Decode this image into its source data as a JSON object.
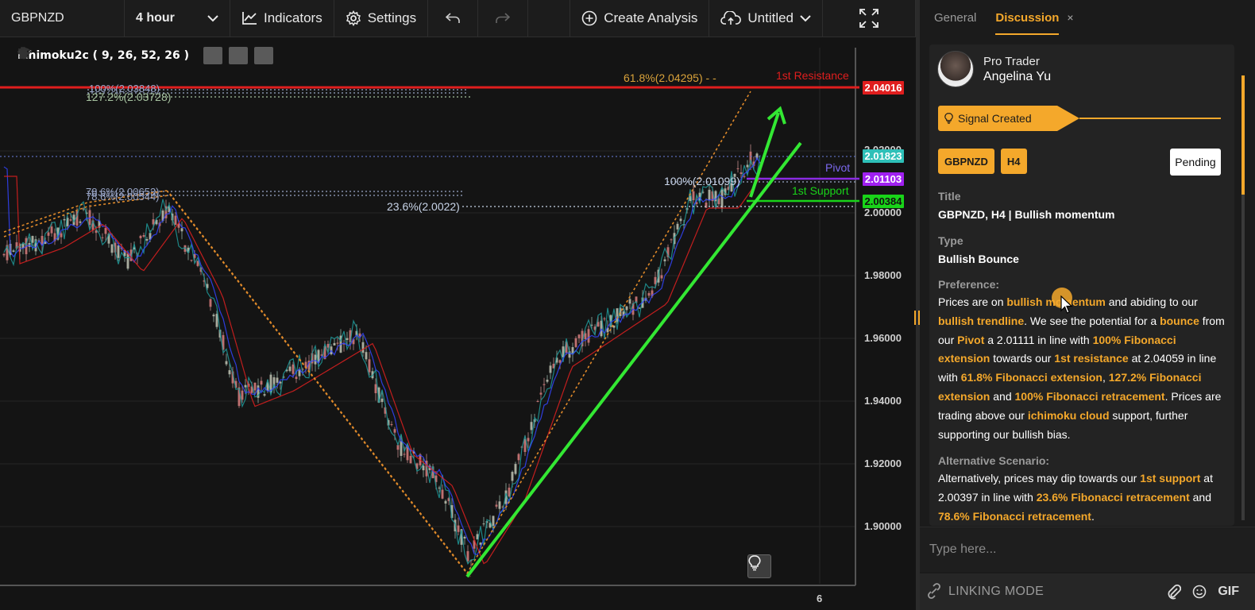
{
  "toolbar": {
    "symbol": "GBPNZD",
    "interval": "4 hour",
    "indicators_label": "Indicators",
    "settings_label": "Settings",
    "create_analysis_label": "Create Analysis",
    "layout_name": "Untitled"
  },
  "chart": {
    "indicator": "Ichimoku2c ( 9, 26, 52, 26 )",
    "price_axis": [
      "2.02000",
      "2.00000",
      "1.98000",
      "1.96000",
      "1.94000",
      "1.92000",
      "1.90000"
    ],
    "price_tags": {
      "resistance": "2.04016",
      "current": "2.01823",
      "pivot": "2.01103",
      "support": "2.00384"
    },
    "line_labels": {
      "resistance": "1st Resistance",
      "pivot": "Pivot",
      "support": "1st Support"
    },
    "fib_labels": {
      "ext_618": "61.8%(2.04295)",
      "retr_100": "100%(2.03848)",
      "ext_1272": "127.2%(2.03728)",
      "retr_786": "78.6%(2.00653)",
      "retr_786b": "78.6%(2.00544)",
      "ext_100": "100%(2.01099)",
      "retr_236": "23.6%(2.0022)"
    },
    "x_tick": "6",
    "colors": {
      "resistance": "#e01e1e",
      "pivot": "#8a2be2",
      "support": "#19d419",
      "trend": "#33e833",
      "current": "#2ec0b8",
      "fib": "#e08a2a"
    }
  },
  "panel": {
    "tabs": [
      "General",
      "Discussion"
    ],
    "active_tab": "Discussion",
    "close_symbol": "×",
    "author_role": "Pro Trader",
    "author_name": "Angelina Yu",
    "signal_status": "Signal Created",
    "tags": [
      "GBPNZD",
      "H4"
    ],
    "state": "Pending",
    "title_label": "Title",
    "title_value": "GBPNZD, H4 | Bullish momentum",
    "type_label": "Type",
    "type_value": "Bullish Bounce",
    "preference_label": "Preference:",
    "alternative_label": "Alternative Scenario:",
    "preference_segments": [
      {
        "t": "Prices are on ",
        "h": false
      },
      {
        "t": "bullish momentum",
        "h": true
      },
      {
        "t": " and abiding to our ",
        "h": false
      },
      {
        "t": "bullish trendline",
        "h": true
      },
      {
        "t": ". We see the potential for a ",
        "h": false
      },
      {
        "t": "bounce",
        "h": true
      },
      {
        "t": " from our ",
        "h": false
      },
      {
        "t": "Pivot",
        "h": true
      },
      {
        "t": " a 2.01111 in line with ",
        "h": false
      },
      {
        "t": "100% Fibonacci extension",
        "h": true
      },
      {
        "t": " towards our ",
        "h": false
      },
      {
        "t": "1st resistance",
        "h": true
      },
      {
        "t": " at 2.04059 in line with ",
        "h": false
      },
      {
        "t": "61.8% Fibonacci extension",
        "h": true
      },
      {
        "t": ", ",
        "h": false
      },
      {
        "t": "127.2% Fibonacci extension",
        "h": true
      },
      {
        "t": " and ",
        "h": false
      },
      {
        "t": "100% Fibonacci retracement",
        "h": true
      },
      {
        "t": ". Prices are trading above our ",
        "h": false
      },
      {
        "t": "ichimoku cloud",
        "h": true
      },
      {
        "t": " support, further supporting our bullish bias.",
        "h": false
      }
    ],
    "alternative_segments": [
      {
        "t": "Alternatively, prices may dip towards our ",
        "h": false
      },
      {
        "t": "1st support",
        "h": true
      },
      {
        "t": " at 2.00397 in line with ",
        "h": false
      },
      {
        "t": "23.6% Fibonacci retracement",
        "h": true
      },
      {
        "t": " and ",
        "h": false
      },
      {
        "t": "78.6% Fibonacci retracement",
        "h": true
      },
      {
        "t": ".",
        "h": false
      }
    ],
    "composer_placeholder": "Type here...",
    "linking_mode": "LINKING MODE",
    "gif_label": "GIF"
  }
}
